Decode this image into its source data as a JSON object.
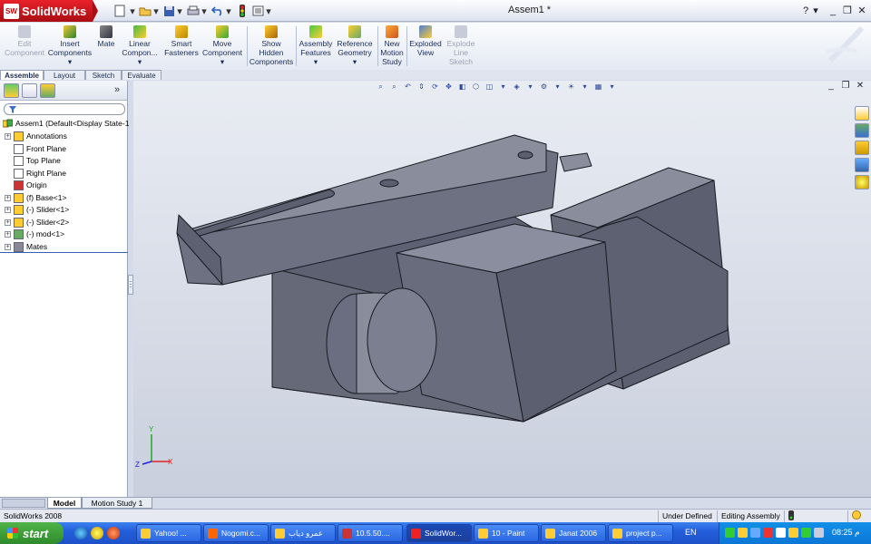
{
  "app": {
    "name": "SolidWorks",
    "logo_badge": "SW",
    "document_title": "Assem1 *"
  },
  "titlebar_controls": {
    "help": "?",
    "minimize": "_",
    "restore": "❐",
    "close": "✕"
  },
  "command_manager": [
    {
      "id": "edit-component",
      "label": "Edit Component",
      "disabled": true
    },
    {
      "id": "insert-components",
      "label": "Insert Components",
      "disabled": false
    },
    {
      "id": "mate",
      "label": "Mate",
      "disabled": false
    },
    {
      "id": "linear-component",
      "label": "Linear Compon...",
      "disabled": false
    },
    {
      "id": "smart-fasteners",
      "label": "Smart Fasteners",
      "disabled": false
    },
    {
      "id": "move-component",
      "label": "Move Component",
      "disabled": false
    },
    {
      "id": "show-hidden-components",
      "label": "Show Hidden Components",
      "disabled": false
    },
    {
      "id": "assembly-features",
      "label": "Assembly Features",
      "disabled": false
    },
    {
      "id": "reference-geometry",
      "label": "Reference Geometry",
      "disabled": false
    },
    {
      "id": "new-motion-study",
      "label": "New Motion Study",
      "disabled": false
    },
    {
      "id": "exploded-view",
      "label": "Exploded View",
      "disabled": false
    },
    {
      "id": "explode-line-sketch",
      "label": "Explode Line Sketch",
      "disabled": true
    }
  ],
  "ribbon_tabs": [
    {
      "label": "Assemble",
      "active": true
    },
    {
      "label": "Layout",
      "active": false
    },
    {
      "label": "Sketch",
      "active": false
    },
    {
      "label": "Evaluate",
      "active": false
    }
  ],
  "feature_tree": {
    "collapse_glyph": "»",
    "root": "Assem1  (Default<Display State-1",
    "items": [
      {
        "label": "Annotations",
        "expandable": true
      },
      {
        "label": "Front Plane",
        "expandable": false
      },
      {
        "label": "Top Plane",
        "expandable": false
      },
      {
        "label": "Right Plane",
        "expandable": false
      },
      {
        "label": "Origin",
        "expandable": false
      },
      {
        "label": "(f) Base<1>",
        "expandable": true
      },
      {
        "label": "(-) Slider<1>",
        "expandable": true
      },
      {
        "label": "(-) Slider<2>",
        "expandable": true
      },
      {
        "label": "(-) mod<1>",
        "expandable": true
      },
      {
        "label": "Mates",
        "expandable": true
      }
    ]
  },
  "bottom_tabs": [
    {
      "label": "Model",
      "active": true
    },
    {
      "label": "Motion Study 1",
      "active": false
    }
  ],
  "status_bar": {
    "app": "SolidWorks 2008",
    "state": "Under Defined",
    "mode": "Editing Assembly"
  },
  "triad": {
    "x": "X",
    "y": "Y",
    "z": "Z"
  },
  "taskbar": {
    "start_label": "start",
    "tasks": [
      {
        "label": "Yahoo! ...",
        "active": false
      },
      {
        "label": "Nogomi.c...",
        "active": false
      },
      {
        "label": "عمرو دياب",
        "active": false
      },
      {
        "label": "10.5.50....",
        "active": false
      },
      {
        "label": "SolidWor...",
        "active": true
      },
      {
        "label": "10 - Paint",
        "active": false
      },
      {
        "label": "Janat 2006",
        "active": false
      },
      {
        "label": "project p...",
        "active": false
      }
    ],
    "language": "EN",
    "clock": "08:25 م"
  },
  "colors": {
    "model_face": "#6b6e80",
    "model_edge": "#1a1a22",
    "viewport_top": "#e9ecf3",
    "viewport_bottom": "#c9cfdd",
    "taskbar": "#245edb"
  }
}
